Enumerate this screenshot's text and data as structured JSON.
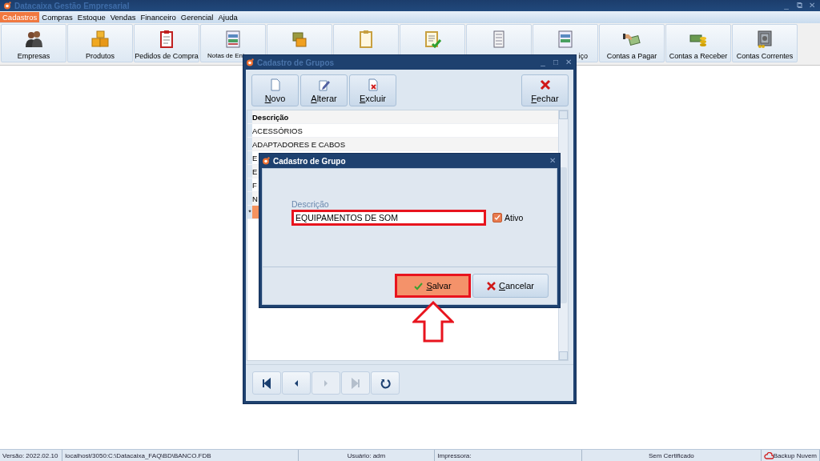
{
  "app": {
    "title": "Datacaixa Gestão Empresarial",
    "controls": [
      "_",
      "⧉",
      "✕"
    ]
  },
  "menu": [
    {
      "label": "Cadastros",
      "selected": true
    },
    {
      "label": "Compras",
      "selected": false
    },
    {
      "label": "Estoque",
      "selected": false
    },
    {
      "label": "Vendas",
      "selected": false
    },
    {
      "label": "Financeiro",
      "selected": false
    },
    {
      "label": "Gerencial",
      "selected": false
    },
    {
      "label": "Ajuda",
      "selected": false
    }
  ],
  "toolbar": [
    {
      "label": "Empresas",
      "kind": "full"
    },
    {
      "label": "Produtos",
      "kind": "full"
    },
    {
      "label": "Pedidos de Compra",
      "kind": "full"
    },
    {
      "label": "Notas de Ent",
      "kind": "cut_right"
    },
    {
      "kind": "covered"
    },
    {
      "kind": "covered"
    },
    {
      "kind": "covered"
    },
    {
      "kind": "covered"
    },
    {
      "label": "iço",
      "kind": "cut_left"
    },
    {
      "label": "Contas a Pagar",
      "kind": "full"
    },
    {
      "label": "Contas a Receber",
      "kind": "full"
    },
    {
      "label": "Contas Correntes",
      "kind": "full"
    }
  ],
  "groups_window": {
    "title": "Cadastro de Grupos",
    "controls": [
      "_",
      "□",
      "✕"
    ],
    "buttons": [
      {
        "label": "Novo",
        "kind": "new"
      },
      {
        "label": "Alterar",
        "kind": "edit"
      },
      {
        "label": "Excluir",
        "kind": "delete"
      },
      {
        "label": "Fechar",
        "kind": "close"
      }
    ],
    "table": {
      "columns": [
        "Descrição"
      ],
      "rows": [
        {
          "cells": [
            "ACESSÓRIOS"
          ],
          "selected": false
        },
        {
          "cells": [
            "ADAPTADORES E CABOS"
          ],
          "selected": false
        },
        {
          "cells": [
            "E"
          ],
          "selected": false
        },
        {
          "cells": [
            "E"
          ],
          "selected": false
        },
        {
          "cells": [
            "F"
          ],
          "selected": false
        },
        {
          "cells": [
            "N"
          ],
          "selected": false
        },
        {
          "indicator": "*",
          "selected": true
        }
      ]
    },
    "navigation": [
      {
        "kind": "first",
        "disabled": false
      },
      {
        "kind": "prev",
        "disabled": false
      },
      {
        "kind": "next",
        "disabled": true
      },
      {
        "kind": "last",
        "disabled": true
      },
      {
        "kind": "refresh",
        "disabled": false
      }
    ]
  },
  "dialog": {
    "title": "Cadastro de Grupo",
    "controls": [
      "✕"
    ],
    "field": {
      "label": "Descrição",
      "value": "EQUIPAMENTOS DE SOM",
      "highlighted": true
    },
    "active": {
      "label": "Ativo",
      "checked": true
    },
    "buttons": [
      {
        "label": "Salvar",
        "kind": "save",
        "highlighted": true
      },
      {
        "label": "Cancelar",
        "kind": "cancel",
        "highlighted": false
      }
    ],
    "pointer_arrow": true
  },
  "status_bar": [
    {
      "text": "Versão: 2022.02.10",
      "kind": "text"
    },
    {
      "text": "localhost/3050:C:\\Datacaixa_FAQ\\BD\\BANCO.FDB",
      "kind": "text"
    },
    {
      "text": "Usuário: adm",
      "kind": "center"
    },
    {
      "text": "Impressora:",
      "kind": "text"
    },
    {
      "text": "Sem Certificado",
      "kind": "center"
    },
    {
      "text": "Backup Nuvem",
      "kind": "cloud"
    }
  ]
}
